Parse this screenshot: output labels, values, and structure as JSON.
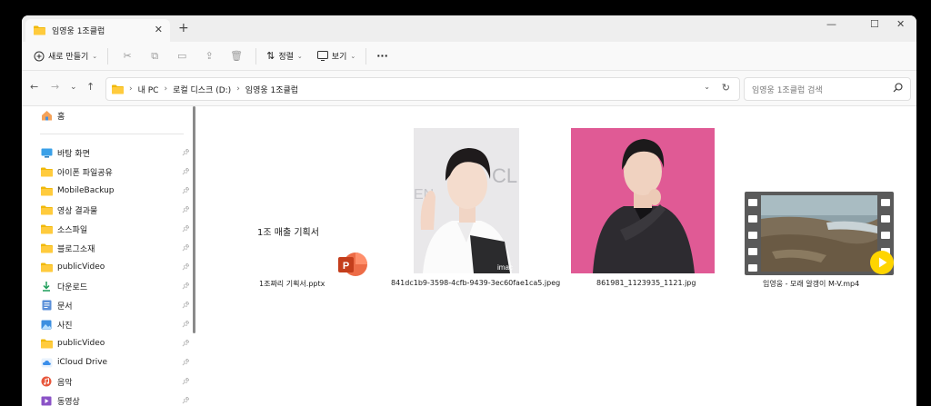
{
  "tab": {
    "title": "임영웅 1조클럽"
  },
  "toolbar": {
    "new_label": "새로 만들기",
    "sort_label": "정렬",
    "view_label": "보기",
    "more_label": "···"
  },
  "address": {
    "crumbs": [
      "내 PC",
      "로컬 디스크 (D:)",
      "임영웅 1조클럽"
    ],
    "search_placeholder": "임영웅 1조클럽 검색"
  },
  "sidebar": {
    "home_label": "홈",
    "items": [
      {
        "label": "바탕 화면",
        "icon": "desktop-icon"
      },
      {
        "label": "아이폰 파일공유",
        "icon": "folder-icon"
      },
      {
        "label": "MobileBackup",
        "icon": "folder-icon"
      },
      {
        "label": "영상 결과물",
        "icon": "folder-icon"
      },
      {
        "label": "소스파일",
        "icon": "folder-icon"
      },
      {
        "label": "블로그소재",
        "icon": "folder-icon"
      },
      {
        "label": "publicVideo",
        "icon": "folder-icon"
      },
      {
        "label": "다운로드",
        "icon": "download-icon"
      },
      {
        "label": "문서",
        "icon": "document-icon"
      },
      {
        "label": "사진",
        "icon": "pictures-icon"
      },
      {
        "label": "publicVideo",
        "icon": "folder-icon"
      },
      {
        "label": "iCloud Drive",
        "icon": "cloud-icon"
      },
      {
        "label": "음악",
        "icon": "music-icon"
      },
      {
        "label": "동영상",
        "icon": "video-icon"
      }
    ]
  },
  "files": [
    {
      "name": "1조짜리 기획서.pptx",
      "thumb_text": "1조 매출 기획서",
      "type": "pptx"
    },
    {
      "name": "841dc1b9-3598-4cfb-9439-3ec60fae1ca5.jpeg",
      "watermark": "imac",
      "type": "jpeg"
    },
    {
      "name": "861981_1123935_1121.jpg",
      "type": "jpg"
    },
    {
      "name": "임영웅 - 모래 알갱이 M-V.mp4",
      "type": "mp4"
    }
  ]
}
